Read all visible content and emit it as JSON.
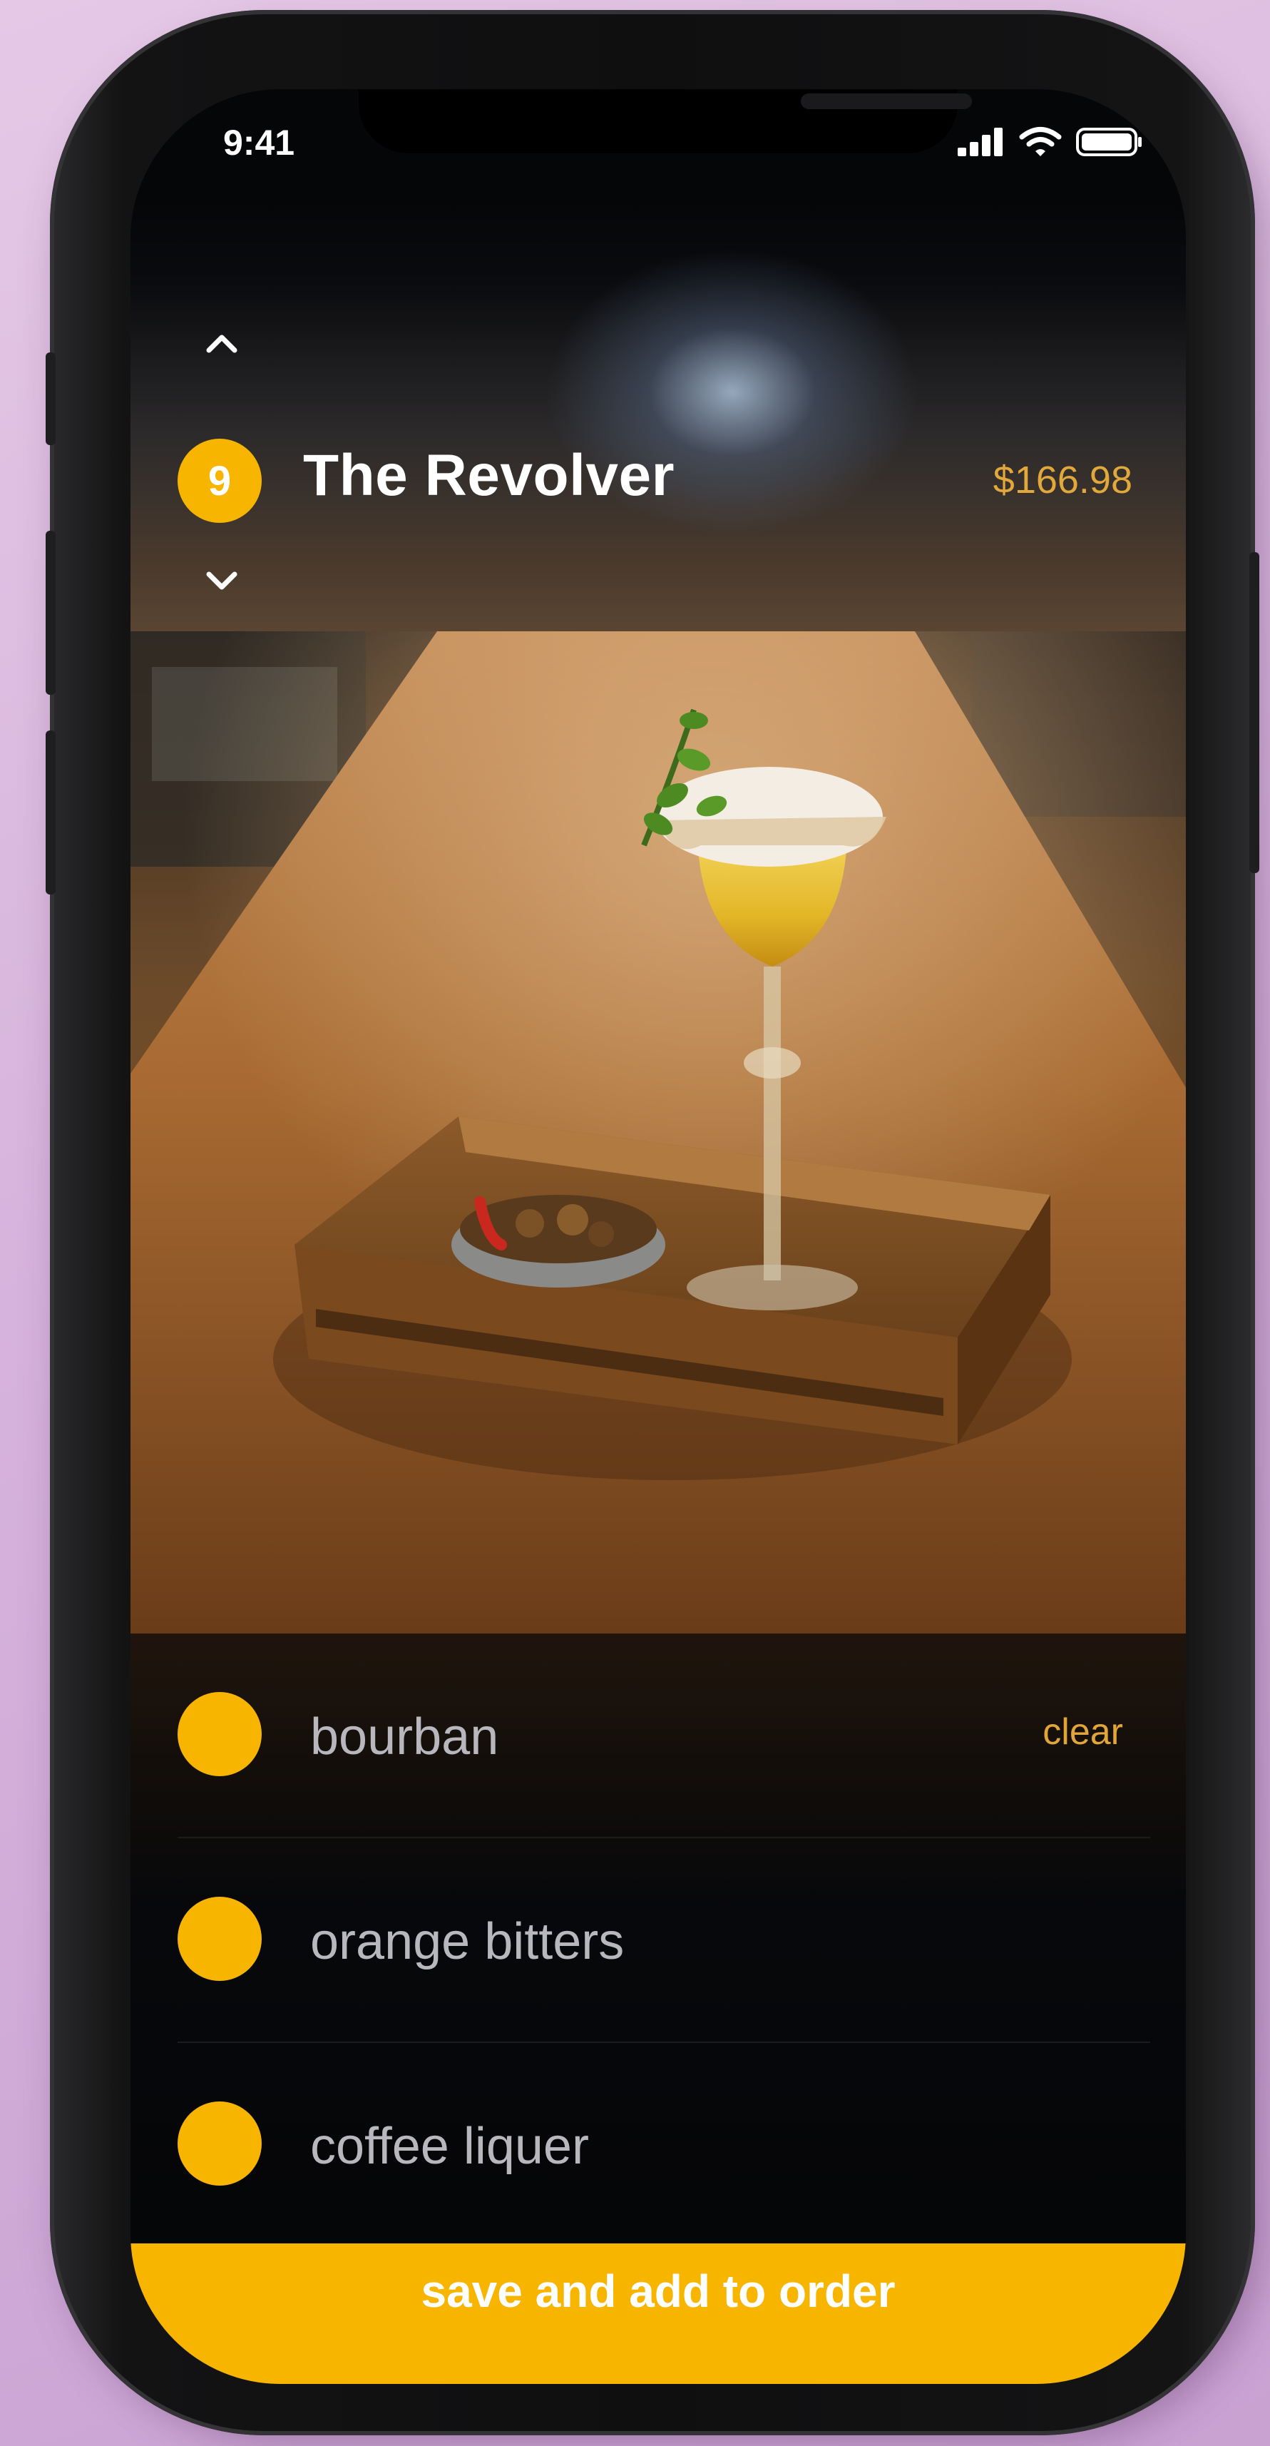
{
  "status_bar": {
    "time": "9:41"
  },
  "header": {
    "item_number": "9",
    "title": "The Revolver",
    "price": "$166.98"
  },
  "ingredients": [
    {
      "label": "bourban",
      "action": "clear"
    },
    {
      "label": "orange bitters"
    },
    {
      "label": "coffee liquer"
    }
  ],
  "footer": {
    "save_label": "save and add to order"
  },
  "colors": {
    "accent": "#f7b500",
    "price": "#e1a83c",
    "background": "#050608"
  },
  "icons": [
    "signal-icon",
    "wifi-icon",
    "battery-icon",
    "chevron-up-icon",
    "chevron-down-icon"
  ]
}
